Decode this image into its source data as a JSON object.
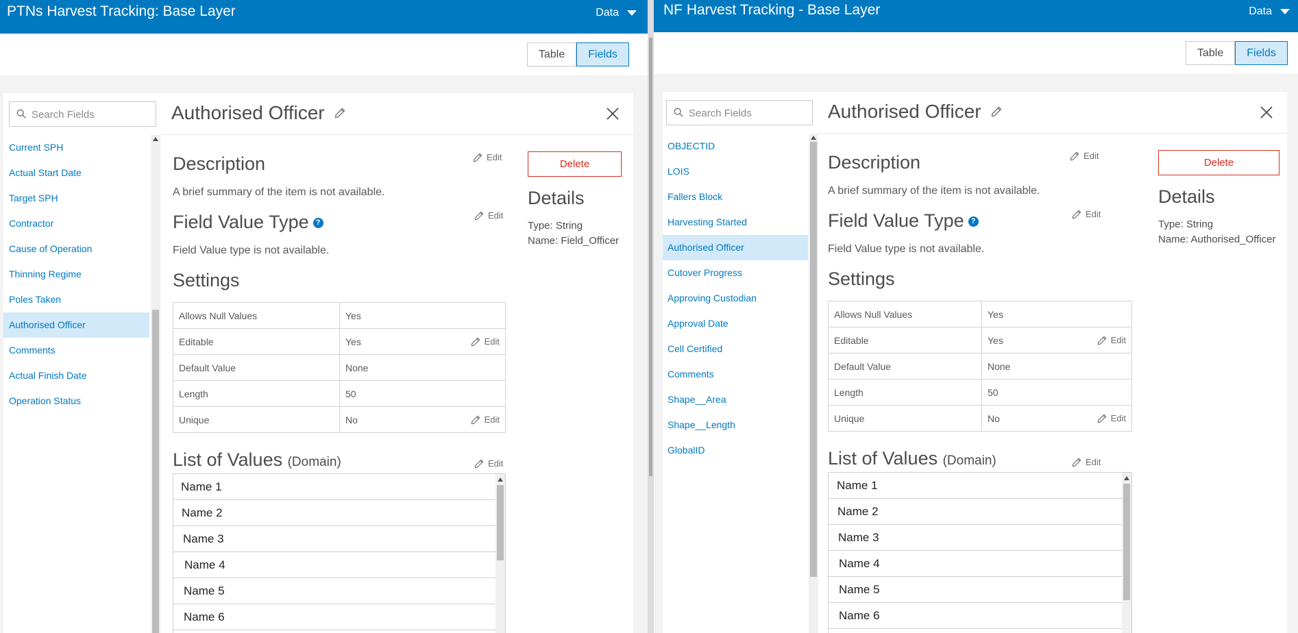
{
  "left": {
    "app_title": "PTNs Harvest Tracking: Base Layer",
    "data_menu": "Data",
    "view_tabs": {
      "table": "Table",
      "fields": "Fields"
    },
    "search_placeholder": "Search Fields",
    "fields": [
      "Current SPH",
      "Actual Start Date",
      "Target SPH",
      "Contractor",
      "Cause of Operation",
      "Thinning Regime",
      "Poles Taken",
      "Authorised Officer",
      "Comments",
      "Actual Finish Date",
      "Operation Status"
    ],
    "selected_field": "Authorised Officer",
    "field_title": "Authorised Officer",
    "description_heading": "Description",
    "description_text": "A brief summary of the item is not available.",
    "fvt_heading": "Field Value Type",
    "fvt_text": "Field Value type is not available.",
    "settings_heading": "Settings",
    "settings": [
      {
        "label": "Allows Null Values",
        "value": "Yes"
      },
      {
        "label": "Editable",
        "value": "Yes"
      },
      {
        "label": "Default Value",
        "value": "None"
      },
      {
        "label": "Length",
        "value": "50"
      },
      {
        "label": "Unique",
        "value": "No"
      }
    ],
    "lov_heading": "List of Values",
    "lov_suffix": "(Domain)",
    "lov_values": [
      "Name 1",
      "Name 2",
      "Name 3",
      "Name 4",
      "Name 5",
      "Name 6"
    ],
    "edit_label": "Edit",
    "delete_label": "Delete",
    "details_heading": "Details",
    "details_type": "Type: String",
    "details_name": "Name: Field_Officer"
  },
  "right": {
    "app_title": "NF Harvest Tracking - Base Layer",
    "data_menu": "Data",
    "view_tabs": {
      "table": "Table",
      "fields": "Fields"
    },
    "search_placeholder": "Search Fields",
    "fields": [
      "OBJECTID",
      "LOIS",
      "Fallers Block",
      "Harvesting Started",
      "Authorised Officer",
      "Cutover Progress",
      "Approving Custodian",
      "Approval Date",
      "Cell Certified",
      "Comments",
      "Shape__Area",
      "Shape__Length",
      "GlobalID"
    ],
    "selected_field": "Authorised Officer",
    "field_title": "Authorised Officer",
    "description_heading": "Description",
    "description_text": "A brief summary of the item is not available.",
    "fvt_heading": "Field Value Type",
    "fvt_text": "Field Value type is not available.",
    "settings_heading": "Settings",
    "settings": [
      {
        "label": "Allows Null Values",
        "value": "Yes"
      },
      {
        "label": "Editable",
        "value": "Yes"
      },
      {
        "label": "Default Value",
        "value": "None"
      },
      {
        "label": "Length",
        "value": "50"
      },
      {
        "label": "Unique",
        "value": "No"
      }
    ],
    "lov_heading": "List of Values",
    "lov_suffix": "(Domain)",
    "lov_values": [
      "Name 1",
      "Name 2",
      "Name 3",
      "Name 4",
      "Name 5",
      "Name 6"
    ],
    "edit_label": "Edit",
    "delete_label": "Delete",
    "details_heading": "Details",
    "details_type": "Type: String",
    "details_name": "Name: Authorised_Officer"
  },
  "colors": {
    "brand": "#0079c1",
    "selected_bg": "#d2e9f9",
    "danger": "#d83020"
  }
}
